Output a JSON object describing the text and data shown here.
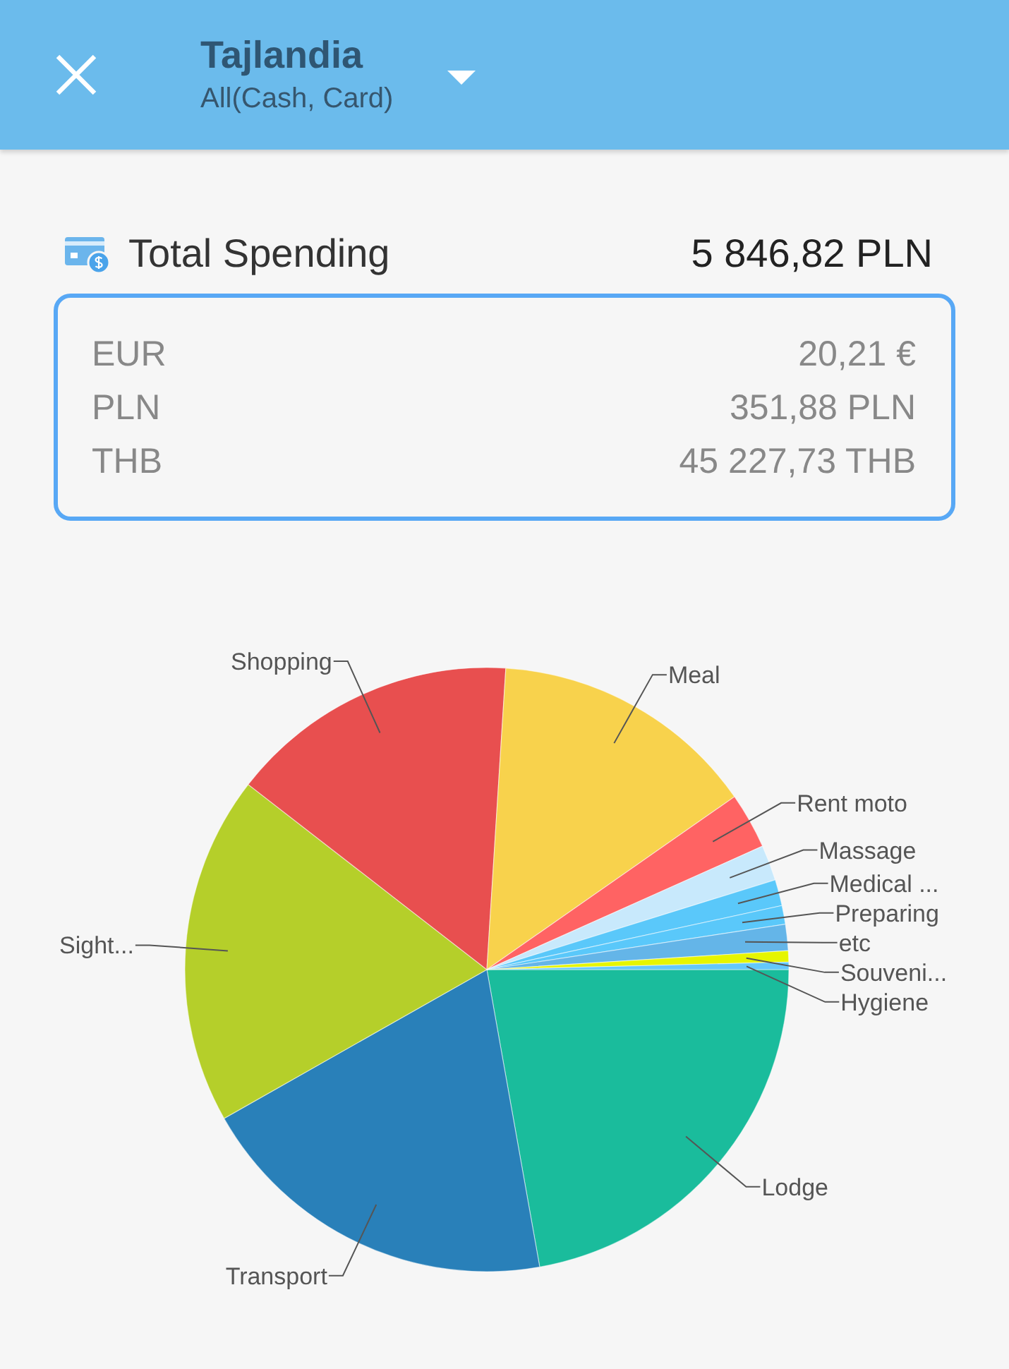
{
  "header": {
    "title": "Tajlandia",
    "subtitle": "All(Cash, Card)"
  },
  "total": {
    "label": "Total Spending",
    "value": "5 846,82 PLN"
  },
  "currencies": [
    {
      "code": "EUR",
      "amount": "20,21 €"
    },
    {
      "code": "PLN",
      "amount": "351,88 PLN"
    },
    {
      "code": "THB",
      "amount": "45 227,73 THB"
    }
  ],
  "chart": {
    "chart_data": {
      "type": "pie",
      "categories": [
        "Lodge",
        "Transport",
        "Sight...",
        "Shopping",
        "Meal",
        "Rent moto",
        "Massage",
        "Medical ...",
        "Preparing",
        "etc",
        "Souveni...",
        "Hygiene"
      ],
      "values": [
        22.2,
        19.6,
        18.7,
        15.5,
        14.3,
        3.0,
        1.9,
        1.4,
        1.0,
        1.4,
        0.6,
        0.4
      ],
      "colors": [
        "#1abc9c",
        "#2980b9",
        "#b5cf2a",
        "#e84f4f",
        "#f8d24c",
        "#ff6363",
        "#c8e9fc",
        "#5ac8fa",
        "#5ac8fa",
        "#64b5e8",
        "#e6f500",
        "#64c8fa"
      ]
    }
  }
}
